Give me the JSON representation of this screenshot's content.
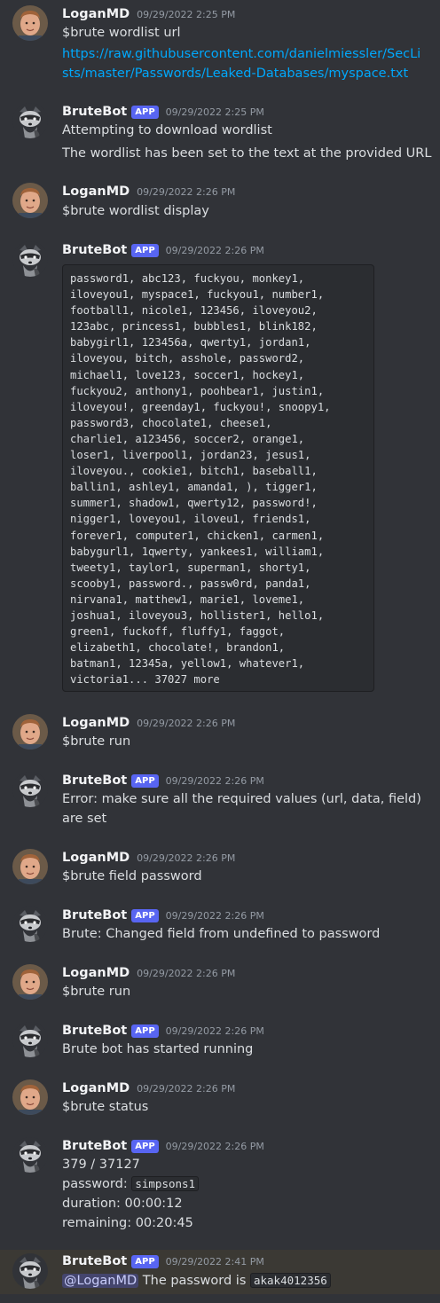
{
  "users": {
    "logan": "LoganMD",
    "bot": "BruteBot",
    "app_badge": "APP"
  },
  "messages": [
    {
      "time": "09/29/2022 2:25 PM",
      "lines": [
        "$brute wordlist url",
        "https://raw.githubusercontent.com/danielmiessler/SecLi",
        "sts/master/Passwords/Leaked-Databases/myspace.txt"
      ]
    },
    {
      "time": "09/29/2022 2:25 PM",
      "lines": [
        "Attempting to download wordlist",
        "The wordlist has been set to the text at the provided URL"
      ]
    },
    {
      "time": "09/29/2022 2:26 PM",
      "lines": [
        "$brute wordlist display"
      ]
    },
    {
      "time": "09/29/2022 2:26 PM",
      "code": [
        "password1, abc123, fuckyou, monkey1,",
        "iloveyou1, myspace1, fuckyou1, number1,",
        "football1, nicole1, 123456, iloveyou2,",
        "123abc, princess1, bubbles1, blink182,",
        "babygirl1, 123456a, qwerty1, jordan1,",
        "iloveyou, bitch, asshole, password2,",
        "michael1, love123, soccer1, hockey1,",
        "fuckyou2, anthony1, poohbear1, justin1,",
        "iloveyou!, greenday1, fuckyou!, snoopy1,",
        "password3, chocolate1, cheese1,",
        "charlie1, a123456, soccer2, orange1,",
        "loser1, liverpool1, jordan23, jesus1,",
        "iloveyou., cookie1, bitch1, baseball1,",
        "ballin1, ashley1, amanda1, ), tigger1,",
        "summer1, shadow1, qwerty12, password!,",
        "nigger1, loveyou1, iloveu1, friends1,",
        "forever1, computer1, chicken1, carmen1,",
        "babygurl1, 1qwerty, yankees1, william1,",
        "tweety1, taylor1, superman1, shorty1,",
        "scooby1, password., passw0rd, panda1,",
        "nirvana1, matthew1, marie1, loveme1,",
        "joshua1, iloveyou3, hollister1, hello1,",
        "green1, fuckoff, fluffy1, faggot,",
        "elizabeth1, chocolate!, brandon1,",
        "batman1, 12345a, yellow1, whatever1,",
        "victoria1... 37027 more"
      ]
    },
    {
      "time": "09/29/2022 2:26 PM",
      "lines": [
        "$brute run"
      ]
    },
    {
      "time": "09/29/2022 2:26 PM",
      "lines": [
        "Error: make sure all the required values (url, data, field)",
        "are set"
      ]
    },
    {
      "time": "09/29/2022 2:26 PM",
      "lines": [
        "$brute field password"
      ]
    },
    {
      "time": "09/29/2022 2:26 PM",
      "lines": [
        "Brute: Changed field from undefined to password"
      ]
    },
    {
      "time": "09/29/2022 2:26 PM",
      "lines": [
        "$brute run"
      ]
    },
    {
      "time": "09/29/2022 2:26 PM",
      "lines": [
        "Brute bot has started running"
      ]
    },
    {
      "time": "09/29/2022 2:26 PM",
      "lines": [
        "$brute status"
      ]
    },
    {
      "time": "09/29/2022 2:26 PM",
      "status": {
        "progress": "379 / 37127",
        "password_label": "password:",
        "password_value": "simpsons1",
        "duration": "duration: 00:00:12",
        "remaining": "remaining: 00:20:45"
      }
    },
    {
      "time": "09/29/2022 2:41 PM",
      "mention": "@LoganMD",
      "text": "The password is",
      "code": "akak4012356"
    }
  ],
  "colors": {
    "background": "#313338",
    "link": "#00a8fc",
    "app_badge": "#5865f2",
    "mention_bg": "#3c4270",
    "highlight_bg": "#3b3934"
  }
}
